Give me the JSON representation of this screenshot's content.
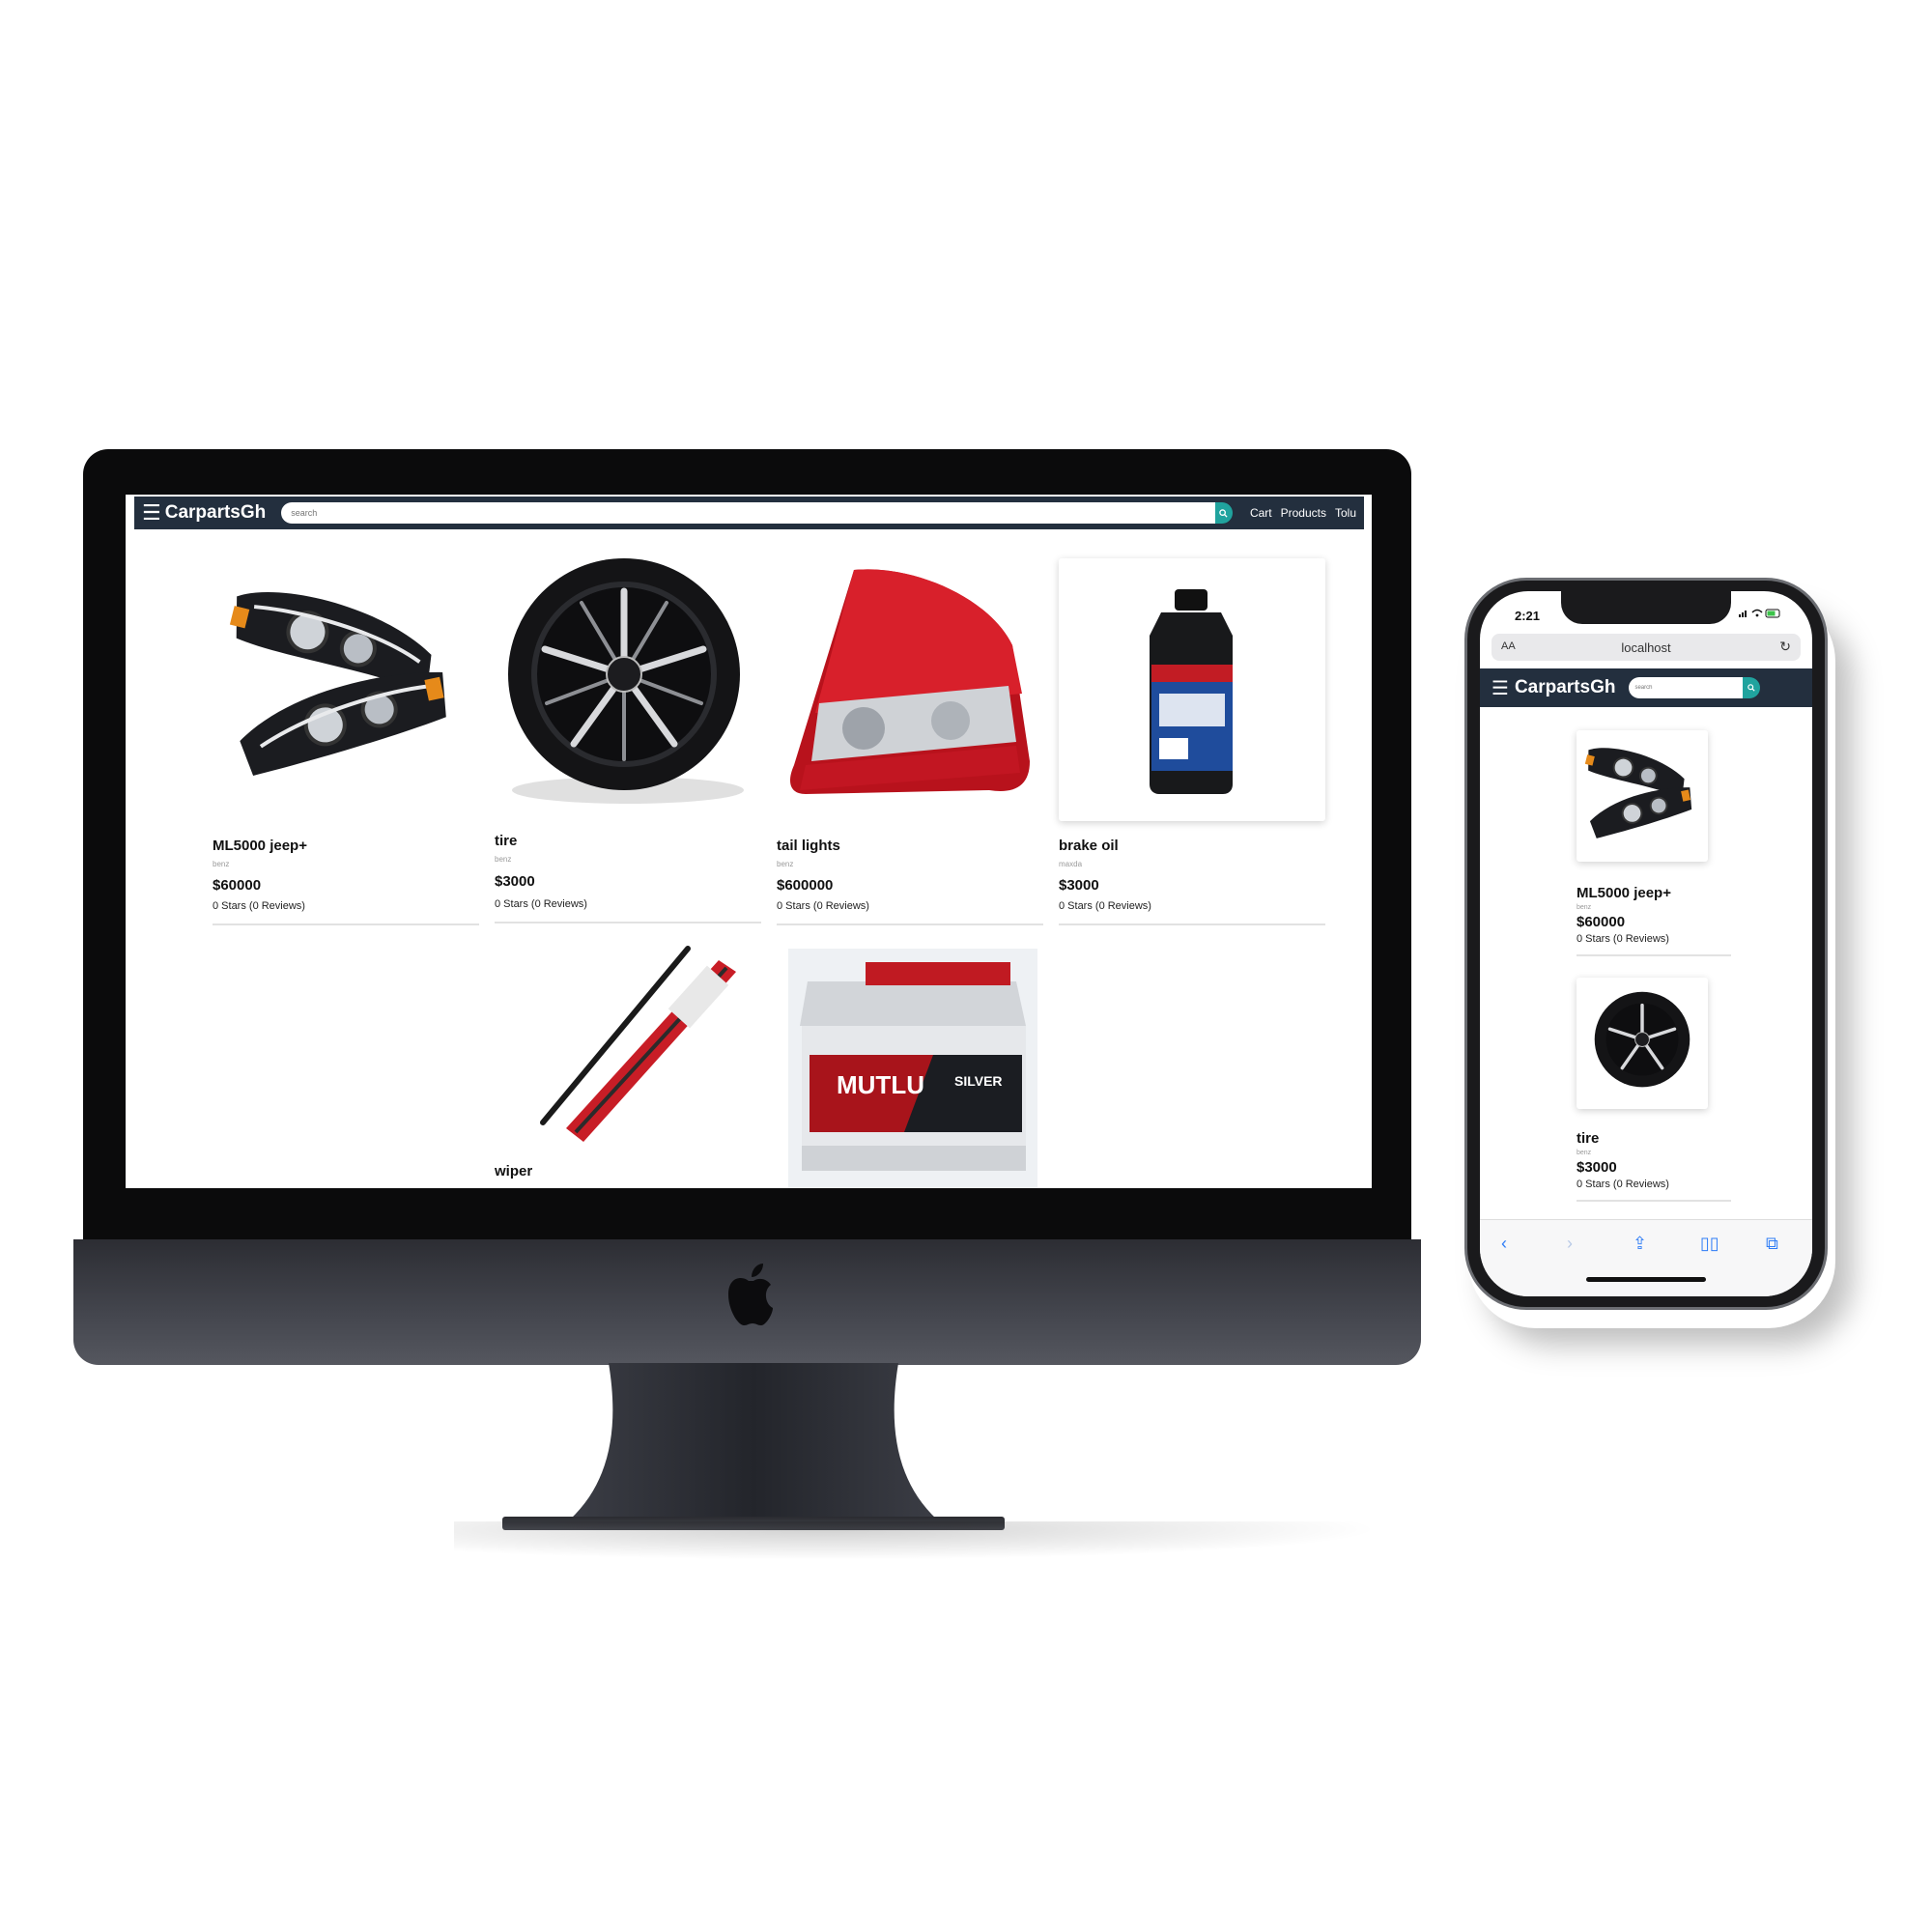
{
  "desktop": {
    "nav": {
      "brand": "CarpartsGh",
      "search_placeholder": "search",
      "links": [
        "Cart",
        "Products",
        "Tolu"
      ]
    },
    "products": [
      {
        "name": "ML5000 jeep+",
        "brand": "benz",
        "price": "$60000",
        "rating": "0 Stars (0 Reviews)",
        "image": "headlights"
      },
      {
        "name": "tire",
        "brand": "benz",
        "price": "$3000",
        "rating": "0 Stars (0 Reviews)",
        "image": "tire"
      },
      {
        "name": "tail lights",
        "brand": "benz",
        "price": "$600000",
        "rating": "0 Stars (0 Reviews)",
        "image": "tail-light"
      },
      {
        "name": "brake oil",
        "brand": "maxda",
        "price": "$3000",
        "rating": "0 Stars (0 Reviews)",
        "image": "brake-fluid-bottle"
      },
      {
        "name": "wiper",
        "image": "wiper-blade"
      },
      {
        "name": "",
        "image": "car-battery",
        "battery_labels": [
          "MUTLU",
          "SILVER"
        ]
      }
    ]
  },
  "mobile": {
    "status_time": "2:21",
    "url": "localhost",
    "url_aa": "AA",
    "nav": {
      "brand": "CarpartsGh",
      "search_placeholder": "search"
    },
    "products": [
      {
        "name": "ML5000 jeep+",
        "brand": "benz",
        "price": "$60000",
        "rating": "0 Stars (0 Reviews)",
        "image": "headlights"
      },
      {
        "name": "tire",
        "brand": "benz",
        "price": "$3000",
        "rating": "0 Stars (0 Reviews)",
        "image": "tire"
      }
    ]
  },
  "colors": {
    "navbar": "#232f3e",
    "search_button": "#20a39e",
    "imac_body": "#3a3c44",
    "safari_blue": "#2f7df6"
  }
}
